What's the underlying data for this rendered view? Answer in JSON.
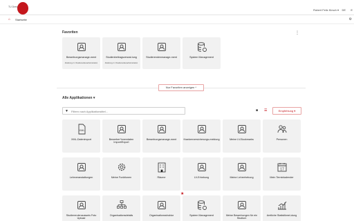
{
  "header": {
    "logo_text": "TU Dresden",
    "user": "Robert Felix Kirsch ▾",
    "lang": "DE",
    "edge": "E"
  },
  "breadcrumb": {
    "home_icon": "home-icon",
    "label": "Startseite",
    "right_icon": "settings-icon"
  },
  "favorites": {
    "title": "Favoriten",
    "menu_icon": "kebab-icon",
    "tiles": [
      {
        "title": "Bewerbungsmanage-ment",
        "subtitle": "Abteilung 2.1 Studierendenadministration",
        "icon": "application-management-icon"
      },
      {
        "title": "Studienbeitragsverwal-tung",
        "subtitle": "Abteilung 2.1 Studierendenadministration",
        "icon": "fee-database-icon"
      },
      {
        "title": "Studierendenmanage-ment",
        "subtitle": "",
        "icon": "students-icon"
      },
      {
        "title": "System Management",
        "subtitle": "",
        "icon": "system-database-icon"
      }
    ],
    "toggle_label": "Nur Favoriten anzeigen ^"
  },
  "apps": {
    "title": "Alle Applikationen ▾",
    "filter_placeholder": "Filtern nach Applikationstitel...",
    "filter_icon": "filter-icon",
    "sort_label": "Empfehlung ▾",
    "rows": [
      [
        {
          "title": "XML-Datenimport",
          "icon": "xml-file-icon",
          "star": false
        },
        {
          "title": "Bewerber*innendaten Import/Export",
          "icon": "import-export-icon",
          "star": false
        },
        {
          "title": "Bewerbungsmanage-ment",
          "icon": "application-management-icon",
          "star": false
        },
        {
          "title": "Krankenversicherungs-meldung",
          "icon": "insurance-icon",
          "star": false
        },
        {
          "title": "Meine LV-Bookmarks",
          "icon": "bookmark-icon",
          "star": false
        },
        {
          "title": "Personen",
          "icon": "persons-icon",
          "star": false
        }
      ],
      [
        {
          "title": "Lehrveranstaltungen",
          "icon": "courses-icon",
          "star": false
        },
        {
          "title": "Meine Funktionen",
          "icon": "gear-icon",
          "star": false
        },
        {
          "title": "Räume",
          "icon": "building-icon",
          "star": false
        },
        {
          "title": "LV-Erhebung",
          "icon": "survey-icon",
          "star": false
        },
        {
          "title": "Meine Lehrerhebung",
          "icon": "teaching-survey-icon",
          "star": false
        },
        {
          "title": "Mein Terminkalender",
          "icon": "calendar-icon",
          "star": false
        }
      ],
      [
        {
          "title": "Studierendenausweis Foto Upload",
          "icon": "photo-upload-icon",
          "star": false
        },
        {
          "title": "Organisationsdetails",
          "icon": "org-chart-icon",
          "star": false
        },
        {
          "title": "Organisationsstruktur",
          "icon": "org-structure-icon",
          "star": false
        },
        {
          "title": "System Management",
          "icon": "system-database-icon",
          "star": true
        },
        {
          "title": "Meine Bewerbungen für ein Studium",
          "icon": "my-applications-icon",
          "star": false
        },
        {
          "title": "Amtliche Statistikmel-dung",
          "icon": "statistics-icon",
          "star": false
        }
      ]
    ]
  },
  "colors": {
    "accent": "#c4161c",
    "tile_bg": "#f1f1f1"
  }
}
